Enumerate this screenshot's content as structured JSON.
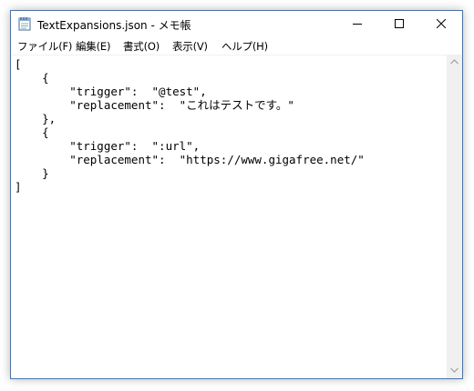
{
  "window": {
    "title": "TextExpansions.json - メモ帳"
  },
  "menu": [
    {
      "label": "ファイル(F)"
    },
    {
      "label": "編集(E)"
    },
    {
      "label": "書式(O)"
    },
    {
      "label": "表示(V)"
    },
    {
      "label": "ヘルプ(H)"
    }
  ],
  "editor": {
    "lines": [
      "[",
      "    {",
      "        \"trigger\":  \"@test\",",
      "        \"replacement\":  \"これはテストです。\"",
      "    },",
      "    {",
      "        \"trigger\":  \":url\",",
      "        \"replacement\":  \"https://www.gigafree.net/\"",
      "    }",
      "]"
    ]
  },
  "colors": {
    "window_border": "#2b79d6",
    "scrollbar_track": "#f0f0f0",
    "scrollbar_arrow": "#a0a0a0"
  },
  "icons": {
    "app": "notepad-icon",
    "minimize": "minimize-icon",
    "maximize": "maximize-icon",
    "close": "close-icon",
    "scroll_up": "scroll-up-arrow-icon",
    "scroll_down": "scroll-down-arrow-icon"
  }
}
